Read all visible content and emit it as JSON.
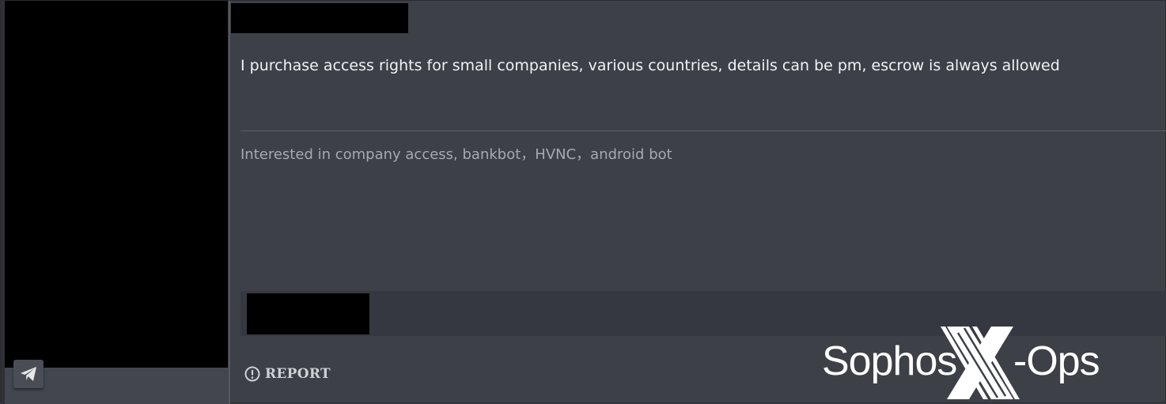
{
  "post": {
    "body": "I purchase access rights for small companies, various countries, details can be pm, escrow is always allowed",
    "signature": "Interested in company access, bankbot，HVNC，android bot",
    "report_label": "REPORT"
  },
  "icons": {
    "telegram": "paper-plane-icon",
    "report": "exclamation-circle-icon"
  },
  "watermark": {
    "brand": "Sophos",
    "letter": "X",
    "suffix": "-Ops"
  },
  "colors": {
    "background": "#3d4047",
    "text_primary": "#f1f2f4",
    "text_secondary": "#a6a9b0",
    "redaction": "#000000",
    "watermark": "#ffffff"
  }
}
